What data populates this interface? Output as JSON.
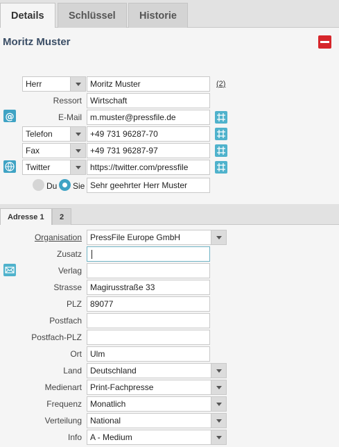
{
  "tabs": [
    {
      "label": "Details",
      "active": true
    },
    {
      "label": "Schlüssel",
      "active": false
    },
    {
      "label": "Historie",
      "active": false
    }
  ],
  "contact": {
    "name": "Moritz Muster",
    "salutation": {
      "selected": "Herr"
    },
    "full_name_value": "Moritz Muster",
    "count_link": "(2)",
    "ressort": {
      "label": "Ressort",
      "value": "Wirtschaft"
    },
    "email": {
      "label": "E-Mail",
      "value": "m.muster@pressfile.de"
    },
    "phone": {
      "type": "Telefon",
      "value": "+49 731 96287-70"
    },
    "fax": {
      "type": "Fax",
      "value": "+49 731 96287-97"
    },
    "social": {
      "type": "Twitter",
      "value": "https://twitter.com/pressfile"
    },
    "address_form": {
      "du_label": "Du",
      "sie_label": "Sie",
      "selected": "Sie",
      "greeting": "Sehr geehrter Herr Muster"
    }
  },
  "address_tabs": [
    {
      "label": "Adresse 1",
      "active": true
    },
    {
      "label": "2",
      "active": false
    }
  ],
  "address": {
    "organisation": {
      "label": "Organisation",
      "value": "PressFile Europe GmbH"
    },
    "zusatz": {
      "label": "Zusatz",
      "value": ""
    },
    "verlag": {
      "label": "Verlag",
      "value": ""
    },
    "strasse": {
      "label": "Strasse",
      "value": "Magirusstraße 33"
    },
    "plz": {
      "label": "PLZ",
      "value": "89077"
    },
    "postfach": {
      "label": "Postfach",
      "value": ""
    },
    "postfach_plz": {
      "label": "Postfach-PLZ",
      "value": ""
    },
    "ort": {
      "label": "Ort",
      "value": "Ulm"
    },
    "land": {
      "label": "Land",
      "value": "Deutschland"
    },
    "medienart": {
      "label": "Medienart",
      "value": "Print-Fachpresse"
    },
    "frequenz": {
      "label": "Frequenz",
      "value": "Monatlich"
    },
    "verteilung": {
      "label": "Verteilung",
      "value": "National"
    },
    "info": {
      "label": "Info",
      "value": "A - Medium"
    }
  },
  "colors": {
    "accent": "#3fa3c4",
    "title": "#3b4e66",
    "danger": "#d6262b"
  }
}
